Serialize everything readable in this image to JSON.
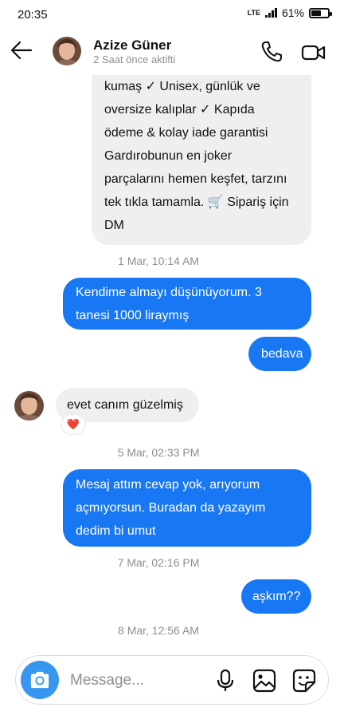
{
  "status_bar": {
    "time": "20:35",
    "network": "LTE",
    "battery": "61%",
    "battery_level": 0.61
  },
  "header": {
    "name": "Azize Güner",
    "status": "2 Saat önce aktifti"
  },
  "messages": {
    "m1_lines": [
      "kumaş ✓  Unisex, günlük ve",
      "oversize kalıplar ✓  Kapıda",
      "ödeme & kolay iade garantisi",
      "Gardırobunun en joker",
      "parçalarını hemen keşfet, tarzını",
      "tek tıkla tamamla. 🛒 Sipariş için",
      "DM"
    ],
    "ts1": "1 Mar, 10:14 AM",
    "m2_lines": [
      "Kendime almayı düşünüyorum. 3",
      "tanesi 1000 liraymış"
    ],
    "m3": "bedava",
    "m4": "evet canım güzelmiş",
    "m4_reaction": "❤️",
    "ts2": "5 Mar, 02:33 PM",
    "m5_lines": [
      "Mesaj attım cevap yok, arıyorum",
      "açmıyorsun. Buradan da yazayım",
      "dedim bi umut"
    ],
    "ts3": "7 Mar, 02:16 PM",
    "m6": "aşkım??",
    "ts4": "8 Mar, 12:56 AM"
  },
  "composer": {
    "placeholder": "Message..."
  },
  "colors": {
    "outgoing_bubble": "#1877f2",
    "incoming_bubble": "#efefef",
    "camera_button": "#3797f0"
  },
  "icons": [
    "back-arrow-icon",
    "phone-icon",
    "video-camera-icon",
    "camera-icon",
    "microphone-icon",
    "gallery-icon",
    "sticker-icon",
    "heart-icon"
  ]
}
